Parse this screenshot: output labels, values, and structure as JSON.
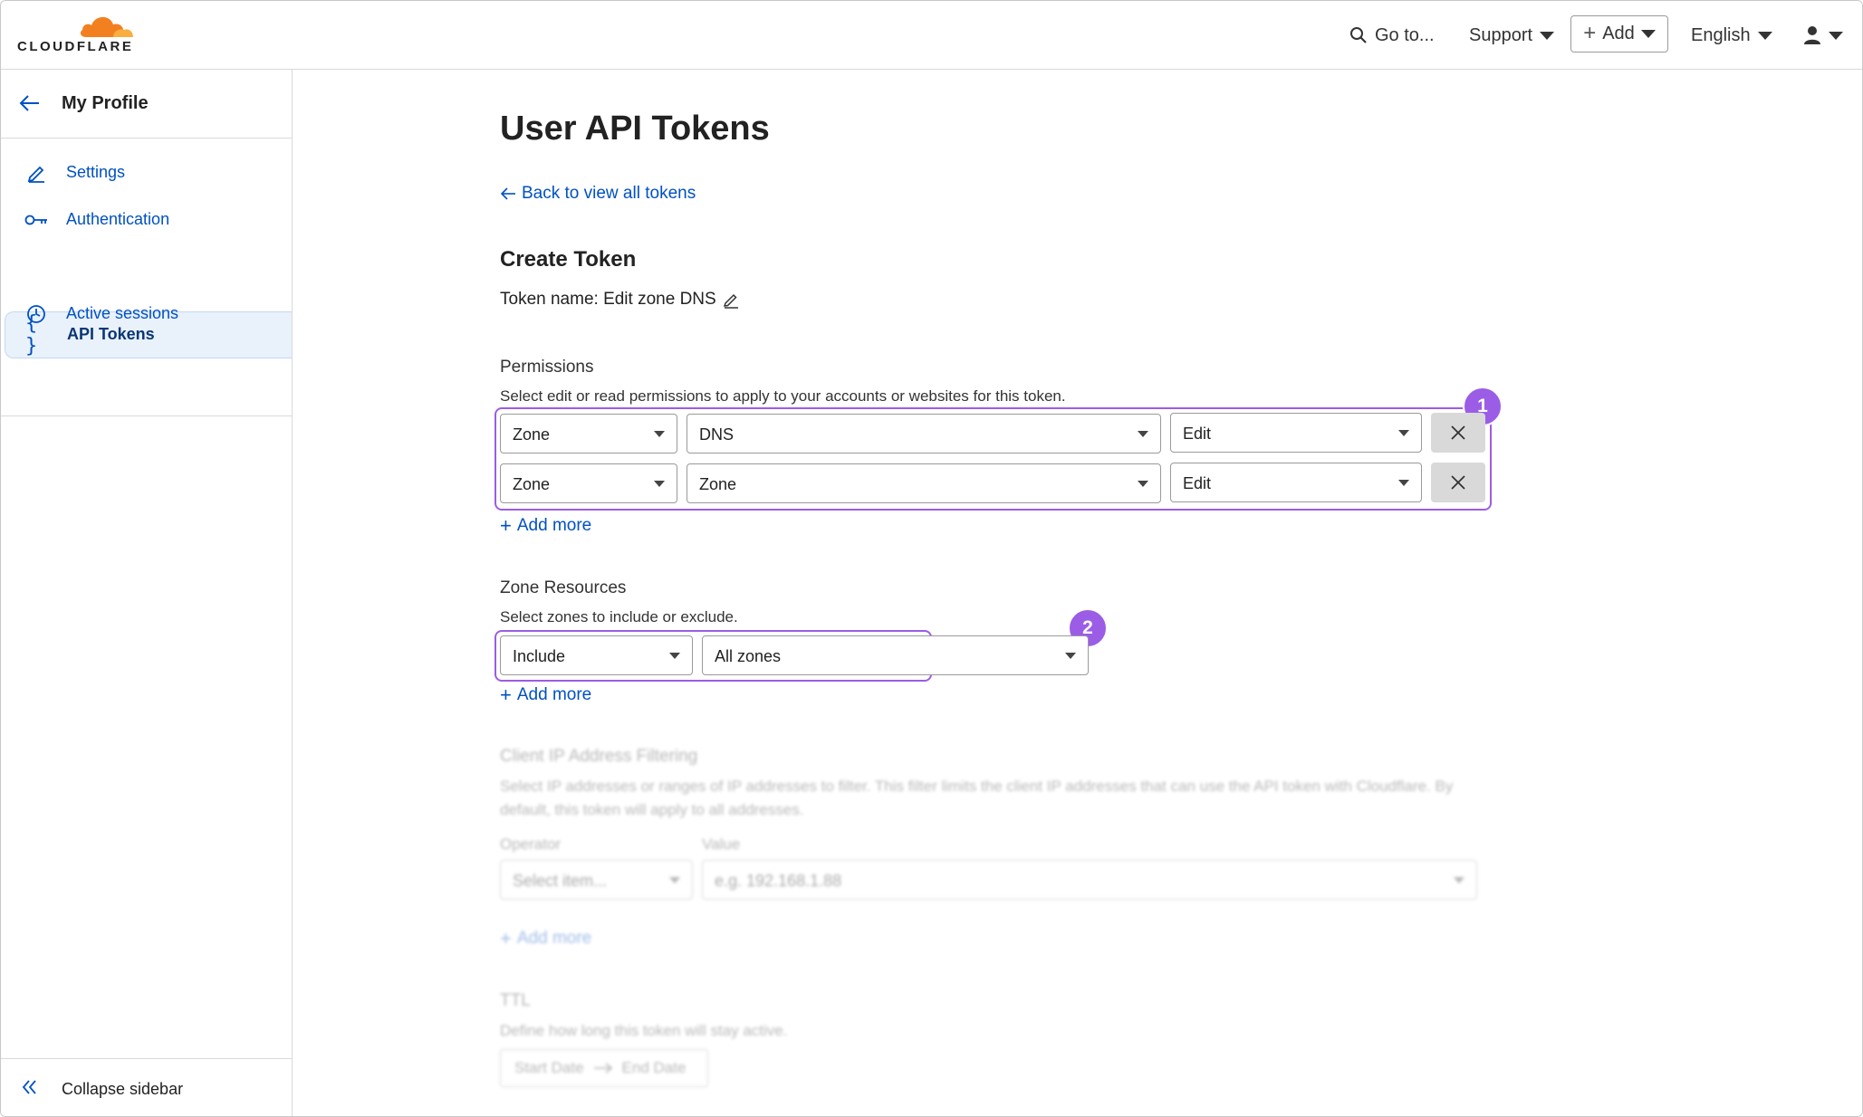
{
  "header": {
    "brand": "CLOUDFLARE",
    "brand_color": "#f38020",
    "goto_label": "Go to...",
    "support_label": "Support",
    "add_label": "Add",
    "language_label": "English"
  },
  "sidebar": {
    "back_title": "My Profile",
    "items": [
      {
        "label": "Settings",
        "icon": "pencil-icon"
      },
      {
        "label": "Authentication",
        "icon": "key-icon"
      },
      {
        "label": "API Tokens",
        "icon": "braces-icon",
        "active": true
      },
      {
        "label": "Active sessions",
        "icon": "clock-icon"
      }
    ],
    "collapse_label": "Collapse sidebar"
  },
  "main": {
    "title": "User API Tokens",
    "back_link": "Back to view all tokens",
    "section_title": "Create Token",
    "token_name": "Token name: Edit zone DNS",
    "permissions": {
      "label": "Permissions",
      "description": "Select edit or read permissions to apply to your accounts or websites for this token.",
      "rows": [
        {
          "scope": "Zone",
          "resource": "DNS",
          "access": "Edit"
        },
        {
          "scope": "Zone",
          "resource": "Zone",
          "access": "Edit"
        }
      ],
      "add_more": "Add more",
      "badge": "1"
    },
    "zone_resources": {
      "label": "Zone Resources",
      "description": "Select zones to include or exclude.",
      "rule": {
        "mode": "Include",
        "target": "All zones"
      },
      "add_more": "Add more",
      "badge": "2"
    },
    "ip_filtering": {
      "label": "Client IP Address Filtering",
      "description_line1": "Select IP addresses or ranges of IP addresses to filter. This filter limits the client IP addresses that can use the API token with Cloudflare. By",
      "description_line2": "default, this token will apply to all addresses.",
      "operator_label": "Operator",
      "value_label": "Value",
      "operator_placeholder": "Select item...",
      "value_placeholder": "e.g. 192.168.1.88",
      "add_more": "Add more"
    },
    "ttl": {
      "label": "TTL",
      "description": "Define how long this token will stay active.",
      "start": "Start Date",
      "end": "End Date"
    }
  },
  "colors": {
    "link": "#0051c3",
    "highlight": "#9b5de5",
    "active_bg": "#e9f1fb"
  }
}
